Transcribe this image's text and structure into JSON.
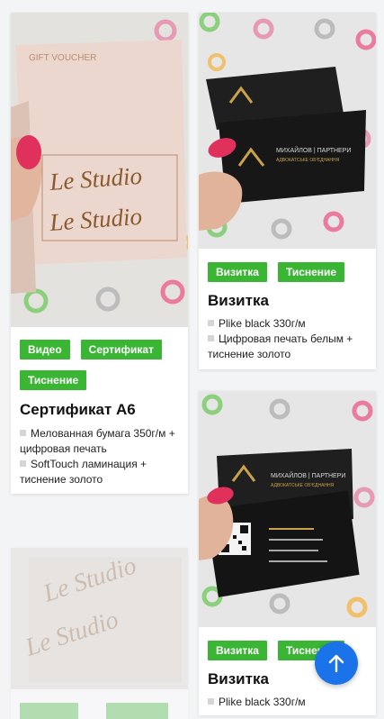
{
  "products": [
    {
      "photo_text": [
        "GIFT VOUCHER",
        "Le Studio",
        "Le Studio"
      ],
      "tags": [
        "Видео",
        "Сертификат",
        "Тиснение"
      ],
      "title": "Сертификат А6",
      "features": [
        "Мелованная бумага 350г/м + цифровая печать",
        "SoftTouch ламинация + тиснение золото"
      ]
    },
    {
      "photo_text": [
        "МИХАЙЛОВ | ПАРТНЕРИ",
        "АДВОКАТСЬКЕ ОБ'ЄДНАННЯ"
      ],
      "tags": [
        "Визитка",
        "Тиснение"
      ],
      "title": "Визитка",
      "features": [
        "Plike black 330г/м",
        "Цифровая печать белым + тиснение золото"
      ]
    },
    {
      "photo_text": [
        "МИХАЙЛОВ | ПАРТНЕРИ",
        "АДВОКАТСЬКЕ ОБ'ЄДНАННЯ"
      ],
      "tags": [
        "Визитка",
        "Тиснение"
      ],
      "title": "Визитка",
      "features": [
        "Plike black 330г/м"
      ]
    },
    {
      "photo_text": [
        "Le Studio",
        "Le Studio"
      ]
    }
  ],
  "scroll_top_icon": "arrow-up-icon",
  "colors": {
    "tag": "#3bb534",
    "fab": "#1a73e8"
  }
}
